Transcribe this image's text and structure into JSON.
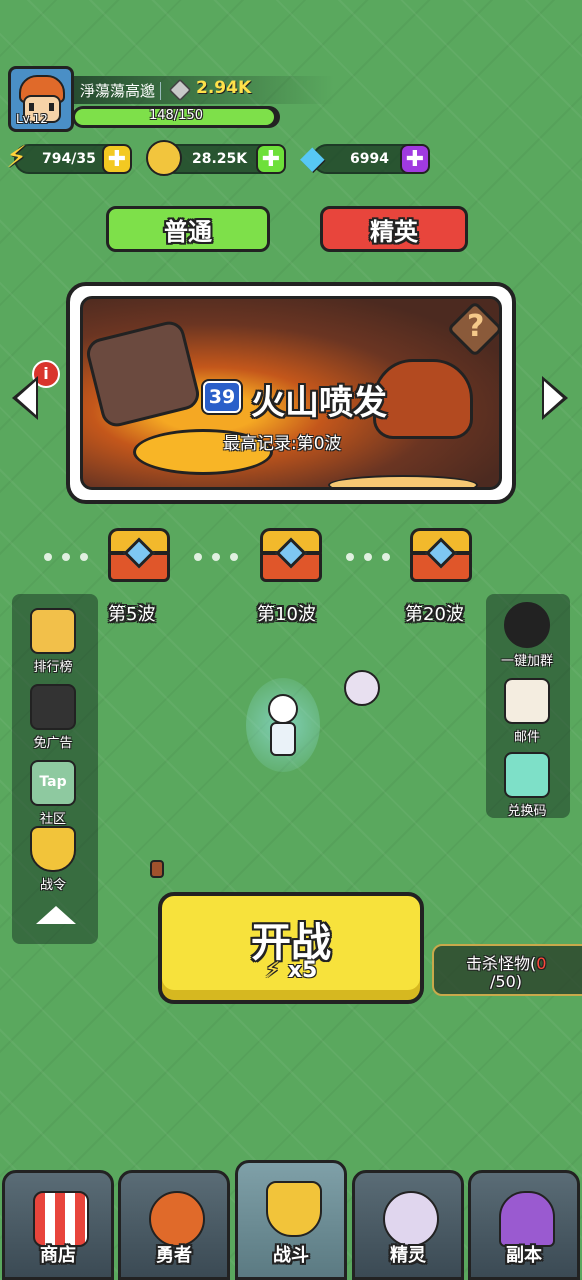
{
  "player": {
    "name": "淨蕩蕩高邈",
    "level": "Lv.12",
    "power": "2.94K",
    "xp": "148/150",
    "xp_fraction": 0.987
  },
  "resources": {
    "energy": "794/35",
    "gold": "28.25K",
    "gems": "6994"
  },
  "modes": {
    "normal": "普通",
    "elite": "精英"
  },
  "stage": {
    "number": "39",
    "name": "火山喷发",
    "record": "最高记录:第0波",
    "help": "?",
    "info": "i"
  },
  "rewards": [
    {
      "label": "第5波"
    },
    {
      "label": "第10波"
    },
    {
      "label": "第20波"
    }
  ],
  "left_menu": [
    {
      "label": "排行榜"
    },
    {
      "label": "免广告"
    },
    {
      "label": "社区",
      "icon_text": "Tap"
    },
    {
      "label": "战令"
    }
  ],
  "right_menu": [
    {
      "label": "一键加群"
    },
    {
      "label": "邮件"
    },
    {
      "label": "兑换码"
    }
  ],
  "start": {
    "label": "开战",
    "cost": "x5"
  },
  "kill_task": {
    "prefix": "击杀怪物(",
    "count": "0",
    "suffix": "/50)"
  },
  "nav": [
    {
      "label": "商店"
    },
    {
      "label": "勇者"
    },
    {
      "label": "战斗"
    },
    {
      "label": "精灵"
    },
    {
      "label": "副本"
    }
  ],
  "colors": {
    "grass": "#5aa85e",
    "normal_btn": "#7ee04a",
    "elite_btn": "#e8453c",
    "start_btn": "#f7e23c",
    "power": "#ffe14a"
  },
  "icons": [
    "energy-icon",
    "gold-icon",
    "gem-icon",
    "power-icon",
    "chest-icon",
    "penguin-icon",
    "mail-icon",
    "ticket-icon"
  ]
}
